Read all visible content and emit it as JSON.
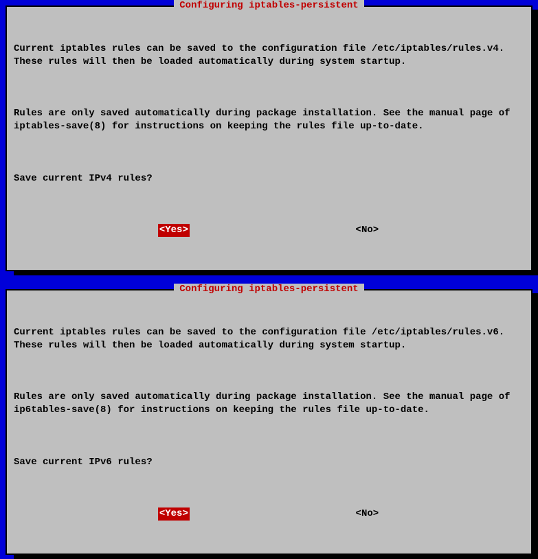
{
  "dialogs": [
    {
      "title": "Configuring iptables-persistent",
      "paragraph1": "Current iptables rules can be saved to the configuration file /etc/iptables/rules.v4. These rules will then be loaded automatically during system startup.",
      "paragraph2": "Rules are only saved automatically during package installation. See the manual page of iptables-save(8) for instructions on keeping the rules file up-to-date.",
      "question": "Save current IPv4 rules?",
      "yes_label": "<Yes>",
      "no_label": "<No>"
    },
    {
      "title": "Configuring iptables-persistent",
      "paragraph1": "Current iptables rules can be saved to the configuration file /etc/iptables/rules.v6. These rules will then be loaded automatically during system startup.",
      "paragraph2": "Rules are only saved automatically during package installation. See the manual page of ip6tables-save(8) for instructions on keeping the rules file up-to-date.",
      "question": "Save current IPv6 rules?",
      "yes_label": "<Yes>",
      "no_label": "<No>"
    }
  ]
}
